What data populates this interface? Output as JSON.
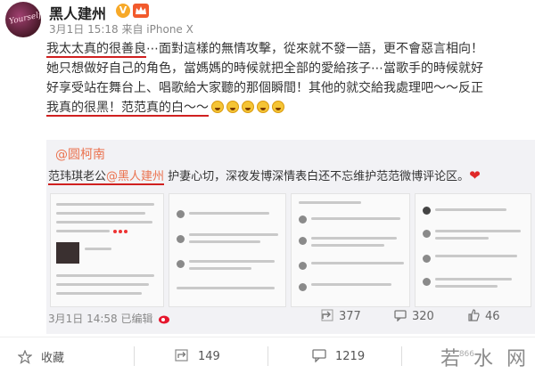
{
  "header": {
    "username": "黑人建州",
    "avatar_text": "Yourself",
    "meta": "3月1日 15:18 来自 iPhone X",
    "verified_icon": "v-badge-icon",
    "member_icon": "crown-badge-icon"
  },
  "post": {
    "line1_underlined": "我太太真的很善良",
    "line1_rest": "⋯面對這樣的無情攻擊，從來就不發一語，更不會惡言相向！",
    "line2": "她只想做好自己的角色，當媽媽的時候就把全部的愛給孩子⋯當歌手的時候就好",
    "line3": "好享受站在舞台上、唱歌給大家聽的那個瞬間！其他的就交給我處理吧～～反正",
    "line4_underlined": "我真的很黑！范范真的白～～",
    "emoji": "laughing-face-icon"
  },
  "repost": {
    "author": "@圆柯南",
    "text_before": "范玮琪老公",
    "mention": "@黑人建州",
    "text_after": " 护妻心切，深夜发博深情表白还不忘维护范范微博评论区。",
    "heart": "❤",
    "meta": "3月1日 14:58 已编辑",
    "actions": {
      "share_count": "377",
      "comment_count": "320",
      "like_count": "46"
    }
  },
  "bottom": {
    "favorite_label": "收藏",
    "share_count": "149",
    "comment_count": "1219",
    "watermark": "若 水 网",
    "watermark_sub": "866"
  },
  "colors": {
    "accent_orange": "#eb7350",
    "underline_red": "#d02020",
    "repost_bg": "#f2f2f5"
  }
}
